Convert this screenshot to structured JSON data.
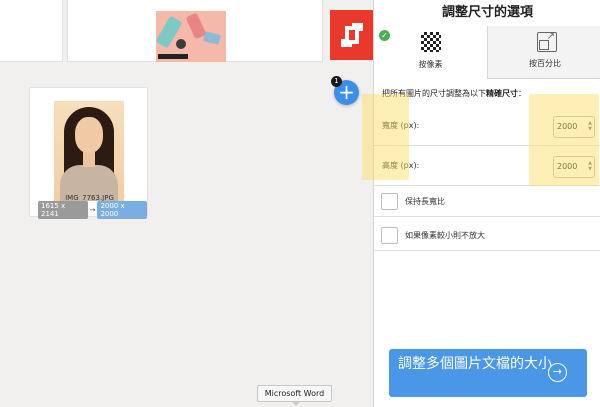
{
  "workspace": {
    "fab": {
      "label": "+",
      "badge": "1"
    },
    "photo_card": {
      "file_name": "IMG_7763.JPG",
      "original_size": "1615 x 2141",
      "arrow": "→",
      "new_size": "2000 x 2000"
    },
    "tooltip": "Microsoft Word"
  },
  "panel": {
    "title": "調整尺寸的選項",
    "tabs": [
      {
        "label": "按像素",
        "icon": "checkerboard-icon",
        "selected": true
      },
      {
        "label": "按百分比",
        "icon": "resize-icon",
        "selected": false
      }
    ],
    "heading_prefix": "把所有圖片的尺寸調整為以下",
    "heading_bold": "精確尺寸",
    "heading_suffix": "：",
    "width": {
      "label": "寬度 (px):",
      "value": "2000"
    },
    "height": {
      "label": "高度 (px):",
      "value": "2000"
    },
    "options": [
      {
        "label": "保持長寬比",
        "checked": false
      },
      {
        "label": "如果像素較小則不放大",
        "checked": false
      }
    ],
    "submit": {
      "label": "調整多個圖片文檔的大小",
      "arrow": "→"
    }
  },
  "colors": {
    "accent": "#4a97e8",
    "highlight": "#fadc5a",
    "brand_tile": "#e8392c",
    "check": "#4caf50"
  }
}
